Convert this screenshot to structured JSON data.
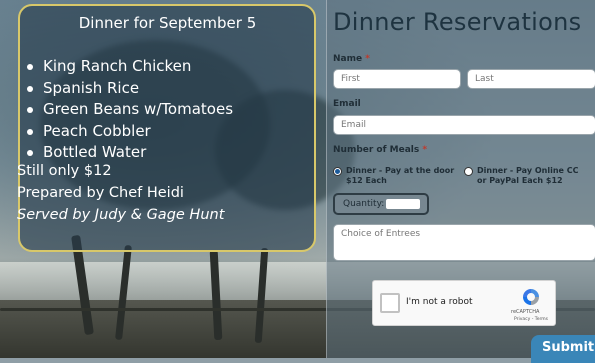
{
  "menu": {
    "title": "Dinner for September 5",
    "items": [
      "King Ranch Chicken",
      "Spanish Rice",
      "Green Beans w/Tomatoes",
      "Peach Cobbler",
      "Bottled Water"
    ],
    "price_text": "Still only $12",
    "chef_text": "Prepared by Chef Heidi",
    "served_text": "Served by Judy & Gage Hunt"
  },
  "form": {
    "title": "Dinner Reservations",
    "name_label": "Name",
    "required_mark": "*",
    "first_placeholder": "First",
    "last_placeholder": "Last",
    "email_label": "Email",
    "email_placeholder": "Email",
    "meals_label": "Number of Meals",
    "option_door": "Dinner - Pay at the door $12 Each",
    "option_online": "Dinner - Pay Online CC or PayPal Each $12",
    "quantity_label": "Quantity:",
    "quantity_value": "",
    "entrees_placeholder": "Choice of Entrees",
    "recaptcha_label": "I'm not a robot",
    "recaptcha_brand": "reCAPTCHA",
    "recaptcha_terms": "Privacy - Terms",
    "submit_label": "Submit"
  },
  "colors": {
    "panel_border": "#d8c86a",
    "submit_bg": "#3a86b8",
    "required": "#c0392b"
  }
}
